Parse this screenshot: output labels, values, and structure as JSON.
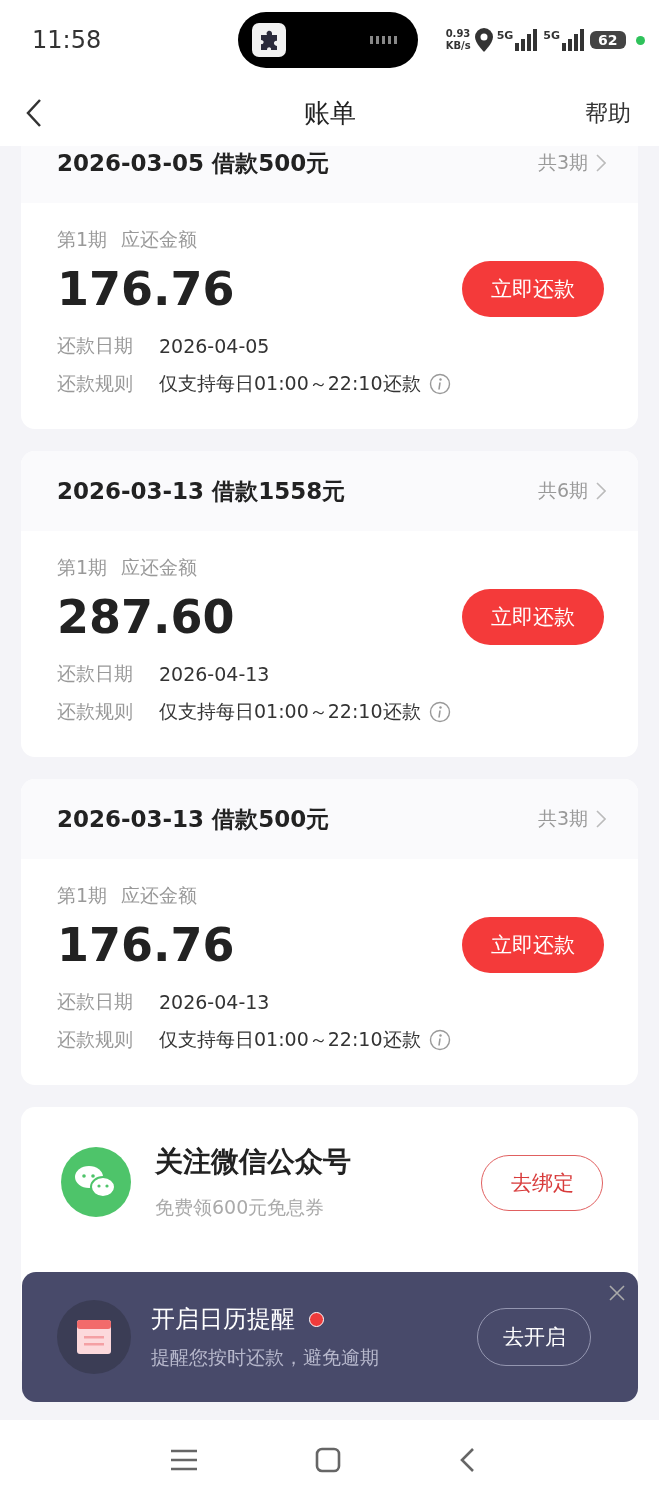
{
  "status_bar": {
    "time": "11:58",
    "speed_value": "0.93",
    "speed_unit": "KB/s",
    "networks": [
      "5G",
      "5G"
    ],
    "battery": "62"
  },
  "header": {
    "title": "账单",
    "action": "帮助"
  },
  "loans": [
    {
      "title": "2026-03-05 借款500元",
      "terms": "共3期",
      "installment": "第1期",
      "amount_label": "应还金额",
      "amount": "176.76",
      "button": "立即还款",
      "rows": [
        {
          "kind": "date",
          "label": "还款日期",
          "value": "2026-04-05"
        },
        {
          "kind": "rule",
          "label": "还款规则",
          "value": "仅支持每日01:00～22:10还款"
        }
      ]
    },
    {
      "title": "2026-03-13 借款1558元",
      "terms": "共6期",
      "installment": "第1期",
      "amount_label": "应还金额",
      "amount": "287.60",
      "button": "立即还款",
      "rows": [
        {
          "kind": "date",
          "label": "还款日期",
          "value": "2026-04-13"
        },
        {
          "kind": "rule",
          "label": "还款规则",
          "value": "仅支持每日01:00～22:10还款"
        }
      ]
    },
    {
      "title": "2026-03-13 借款500元",
      "terms": "共3期",
      "installment": "第1期",
      "amount_label": "应还金额",
      "amount": "176.76",
      "button": "立即还款",
      "rows": [
        {
          "kind": "date",
          "label": "还款日期",
          "value": "2026-04-13"
        },
        {
          "kind": "rule",
          "label": "还款规则",
          "value": "仅支持每日01:00～22:10还款"
        }
      ]
    }
  ],
  "wechat": {
    "title": "关注微信公众号",
    "subtitle": "免费领600元免息券",
    "button": "去绑定"
  },
  "reminder": {
    "title": "开启日历提醒",
    "unread": true,
    "subtitle": "提醒您按时还款，避免逾期",
    "button": "去开启"
  }
}
